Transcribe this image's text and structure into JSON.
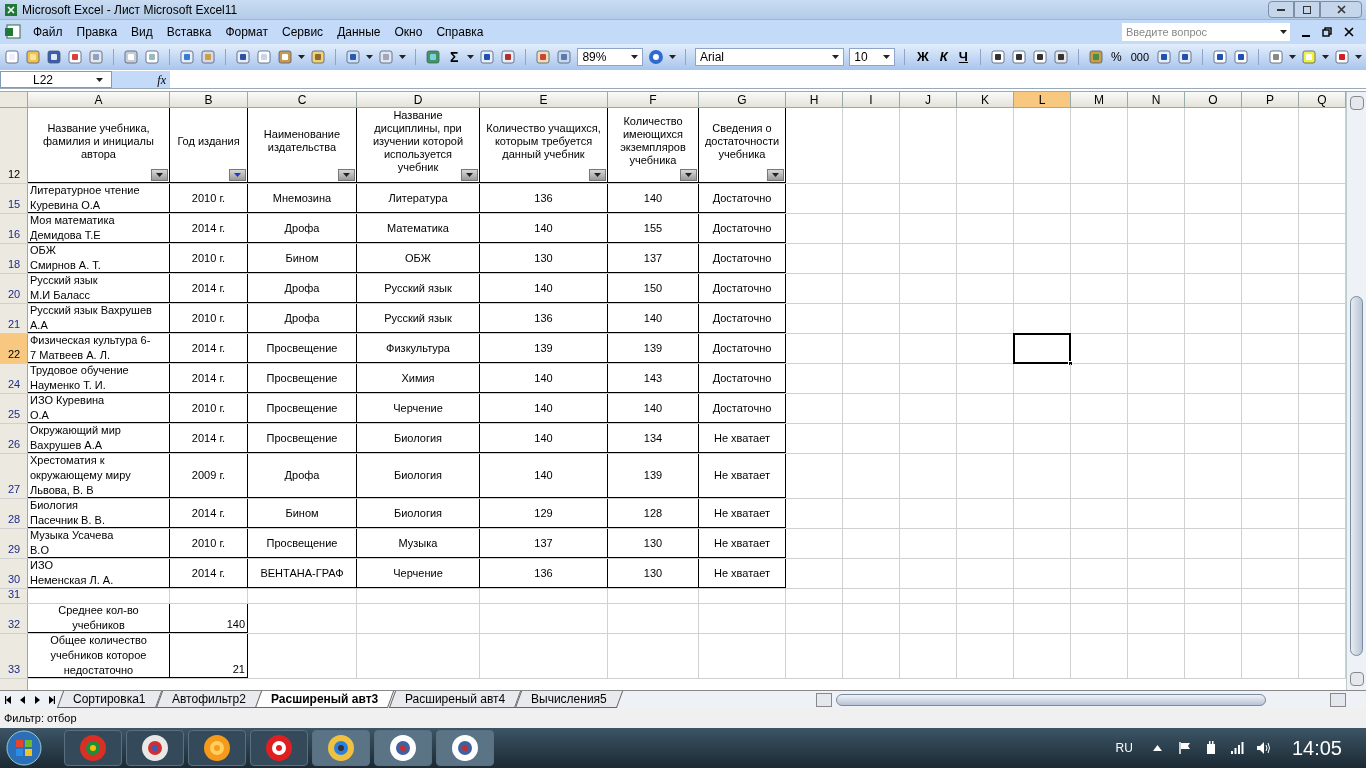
{
  "window": {
    "title": "Microsoft Excel - Лист Microsoft Excel11"
  },
  "menu": [
    "Файл",
    "Правка",
    "Вид",
    "Вставка",
    "Формат",
    "Сервис",
    "Данные",
    "Окно",
    "Справка"
  ],
  "help_field": {
    "placeholder": "Введите вопрос"
  },
  "toolbar": {
    "sum": "Σ",
    "zoom": "89%",
    "font": "Arial",
    "size": "10",
    "bold": "Ж",
    "italic": "К",
    "underline": "Ч",
    "percent": "%",
    "thousands": "000"
  },
  "formula_bar": {
    "name_box": "L22",
    "fx": "fx"
  },
  "columns": [
    {
      "label": "A",
      "selected": false
    },
    {
      "label": "B",
      "selected": false
    },
    {
      "label": "C",
      "selected": false
    },
    {
      "label": "D",
      "selected": false
    },
    {
      "label": "E",
      "selected": false
    },
    {
      "label": "F",
      "selected": false
    },
    {
      "label": "G",
      "selected": false
    },
    {
      "label": "H",
      "selected": false
    },
    {
      "label": "I",
      "selected": false
    },
    {
      "label": "J",
      "selected": false
    },
    {
      "label": "K",
      "selected": false
    },
    {
      "label": "L",
      "selected": true
    },
    {
      "label": "M",
      "selected": false
    },
    {
      "label": "N",
      "selected": false
    },
    {
      "label": "O",
      "selected": false
    },
    {
      "label": "P",
      "selected": false
    },
    {
      "label": "Q",
      "selected": false
    }
  ],
  "header_row": {
    "number": "12",
    "cells": [
      {
        "text": "Название учебника,\nфамилия и инициалы\nавтора",
        "filter_active": false
      },
      {
        "text": "Год издания",
        "filter_active": true
      },
      {
        "text": "Наименование\nиздательства",
        "filter_active": false
      },
      {
        "text": "Название\nдисциплины, при\nизучении которой\nиспользуется\nучебник",
        "filter_active": false
      },
      {
        "text": "Количество учащихся,\nкоторым требуется\nданный учебник",
        "filter_active": false
      },
      {
        "text": "Количество\nимеющихся\nэкземпляров\nучебника",
        "filter_active": false
      },
      {
        "text": "Сведения о\nдостаточности\nучебника",
        "filter_active": false
      }
    ]
  },
  "rows": [
    {
      "number": "15",
      "kind": "data",
      "selected": false,
      "cells": [
        "Литературное чтение\nКуревина О.А",
        "2010 г.",
        "Мнемозина",
        "Литература",
        "136",
        "140",
        "Достаточно"
      ]
    },
    {
      "number": "16",
      "kind": "data",
      "selected": false,
      "cells": [
        "Моя математика\nДемидова Т.Е",
        "2014 г.",
        "Дрофа",
        "Математика",
        "140",
        "155",
        "Достаточно"
      ]
    },
    {
      "number": "18",
      "kind": "data",
      "selected": false,
      "cells": [
        "ОБЖ\nСмирнов А. Т.",
        "2010 г.",
        "Бином",
        "ОБЖ",
        "130",
        "137",
        "Достаточно"
      ]
    },
    {
      "number": "20",
      "kind": "data",
      "selected": false,
      "cells": [
        " Русский язык\nМ.И Баласс",
        "2014 г.",
        "Дрофа",
        "Русский язык",
        "140",
        "150",
        "Достаточно"
      ]
    },
    {
      "number": "21",
      "kind": "data",
      "selected": false,
      "cells": [
        "Русский язык Вахрушев\nА.А",
        "2010 г.",
        "Дрофа",
        "Русский язык",
        "136",
        "140",
        "Достаточно"
      ]
    },
    {
      "number": "22",
      "kind": "data",
      "selected": true,
      "cells": [
        "Физическая культура 6-\n7  Матвеев А. Л.",
        "2014 г.",
        "Просвещение",
        "Физкультура",
        "139",
        "139",
        "Достаточно"
      ]
    },
    {
      "number": "24",
      "kind": "data",
      "selected": false,
      "cells": [
        "Трудовое обучение\nНауменко Т. И.",
        "2014 г.",
        "Просвещение",
        "Химия",
        "140",
        "143",
        "Достаточно"
      ]
    },
    {
      "number": "25",
      "kind": "data",
      "selected": false,
      "cells": [
        " ИЗО Куревина\nО.А",
        "2010 г.",
        "Просвещение",
        "Черчение",
        "140",
        "140",
        "Достаточно"
      ]
    },
    {
      "number": "26",
      "kind": "data",
      "selected": false,
      "cells": [
        "Окружающий мир\nВахрушев А.А",
        "2014 г.",
        "Просвещение",
        "Биология",
        "140",
        "134",
        "Не хватает"
      ]
    },
    {
      "number": "27",
      "kind": "data",
      "selected": false,
      "cells": [
        "Хрестоматия к\nокружающему миру\nЛьвова, В. В",
        "2009 г.",
        "Дрофа",
        "Биология",
        "140",
        "139",
        "Не хватает"
      ]
    },
    {
      "number": "28",
      "kind": "data",
      "selected": false,
      "cells": [
        "Биология\nПасечник В. В.",
        "2014 г.",
        "Бином",
        "Биология",
        "129",
        "128",
        "Не хватает"
      ]
    },
    {
      "number": "29",
      "kind": "data",
      "selected": false,
      "cells": [
        " Музыка Усачева\nВ.О",
        "2010 г.",
        "Просвещение",
        "Музыка",
        "137",
        "130",
        "Не хватает"
      ]
    },
    {
      "number": "30",
      "kind": "data",
      "selected": false,
      "cells": [
        "ИЗО\nНеменская Л. А.",
        "2014 г.",
        "ВЕНТАНА-ГРАФ",
        "Черчение",
        "136",
        "130",
        "Не хватает"
      ]
    },
    {
      "number": "31",
      "kind": "empty",
      "selected": false,
      "cells": []
    },
    {
      "number": "32",
      "kind": "summary",
      "selected": false,
      "cells": [
        "Среднее кол-во\nучебников",
        "140"
      ]
    },
    {
      "number": "33",
      "kind": "summary",
      "selected": false,
      "cells": [
        "Общее количество\nучебников которое\nнедостаточно",
        "21"
      ]
    }
  ],
  "sheet_tabs": [
    {
      "label": "Сортировка1",
      "selected": false
    },
    {
      "label": "Автофильтр2",
      "selected": false
    },
    {
      "label": "Расширеный авт3",
      "selected": true
    },
    {
      "label": "Расширеный авт4",
      "selected": false
    },
    {
      "label": "Вычисления5",
      "selected": false
    }
  ],
  "status_bar": {
    "text": "Фильтр: отбор"
  },
  "taskbar": {
    "language": "RU",
    "clock": "14:05"
  }
}
